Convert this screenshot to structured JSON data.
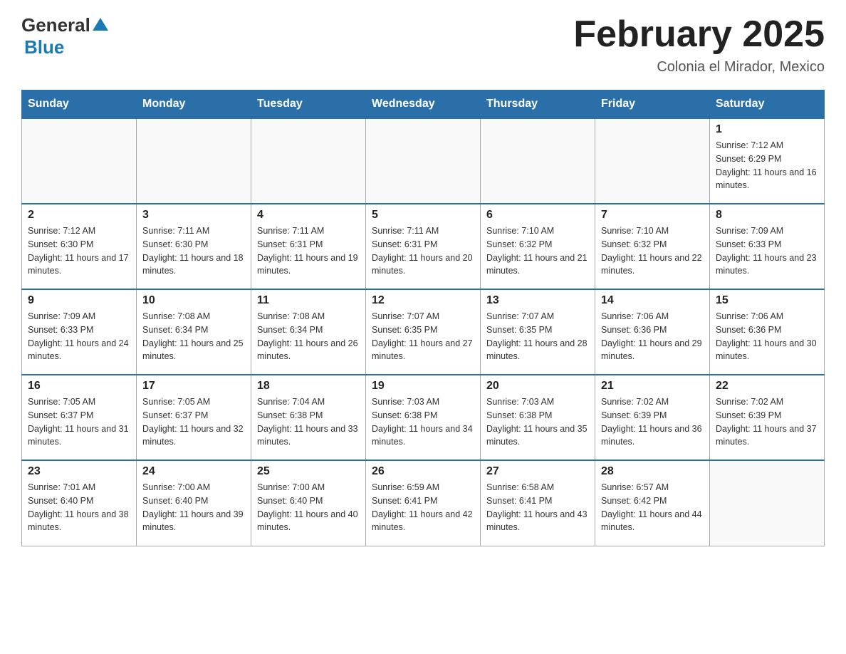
{
  "header": {
    "logo_general": "General",
    "logo_blue": "Blue",
    "month_title": "February 2025",
    "location": "Colonia el Mirador, Mexico"
  },
  "days_of_week": [
    "Sunday",
    "Monday",
    "Tuesday",
    "Wednesday",
    "Thursday",
    "Friday",
    "Saturday"
  ],
  "weeks": [
    [
      {
        "day": "",
        "info": ""
      },
      {
        "day": "",
        "info": ""
      },
      {
        "day": "",
        "info": ""
      },
      {
        "day": "",
        "info": ""
      },
      {
        "day": "",
        "info": ""
      },
      {
        "day": "",
        "info": ""
      },
      {
        "day": "1",
        "info": "Sunrise: 7:12 AM\nSunset: 6:29 PM\nDaylight: 11 hours and 16 minutes."
      }
    ],
    [
      {
        "day": "2",
        "info": "Sunrise: 7:12 AM\nSunset: 6:30 PM\nDaylight: 11 hours and 17 minutes."
      },
      {
        "day": "3",
        "info": "Sunrise: 7:11 AM\nSunset: 6:30 PM\nDaylight: 11 hours and 18 minutes."
      },
      {
        "day": "4",
        "info": "Sunrise: 7:11 AM\nSunset: 6:31 PM\nDaylight: 11 hours and 19 minutes."
      },
      {
        "day": "5",
        "info": "Sunrise: 7:11 AM\nSunset: 6:31 PM\nDaylight: 11 hours and 20 minutes."
      },
      {
        "day": "6",
        "info": "Sunrise: 7:10 AM\nSunset: 6:32 PM\nDaylight: 11 hours and 21 minutes."
      },
      {
        "day": "7",
        "info": "Sunrise: 7:10 AM\nSunset: 6:32 PM\nDaylight: 11 hours and 22 minutes."
      },
      {
        "day": "8",
        "info": "Sunrise: 7:09 AM\nSunset: 6:33 PM\nDaylight: 11 hours and 23 minutes."
      }
    ],
    [
      {
        "day": "9",
        "info": "Sunrise: 7:09 AM\nSunset: 6:33 PM\nDaylight: 11 hours and 24 minutes."
      },
      {
        "day": "10",
        "info": "Sunrise: 7:08 AM\nSunset: 6:34 PM\nDaylight: 11 hours and 25 minutes."
      },
      {
        "day": "11",
        "info": "Sunrise: 7:08 AM\nSunset: 6:34 PM\nDaylight: 11 hours and 26 minutes."
      },
      {
        "day": "12",
        "info": "Sunrise: 7:07 AM\nSunset: 6:35 PM\nDaylight: 11 hours and 27 minutes."
      },
      {
        "day": "13",
        "info": "Sunrise: 7:07 AM\nSunset: 6:35 PM\nDaylight: 11 hours and 28 minutes."
      },
      {
        "day": "14",
        "info": "Sunrise: 7:06 AM\nSunset: 6:36 PM\nDaylight: 11 hours and 29 minutes."
      },
      {
        "day": "15",
        "info": "Sunrise: 7:06 AM\nSunset: 6:36 PM\nDaylight: 11 hours and 30 minutes."
      }
    ],
    [
      {
        "day": "16",
        "info": "Sunrise: 7:05 AM\nSunset: 6:37 PM\nDaylight: 11 hours and 31 minutes."
      },
      {
        "day": "17",
        "info": "Sunrise: 7:05 AM\nSunset: 6:37 PM\nDaylight: 11 hours and 32 minutes."
      },
      {
        "day": "18",
        "info": "Sunrise: 7:04 AM\nSunset: 6:38 PM\nDaylight: 11 hours and 33 minutes."
      },
      {
        "day": "19",
        "info": "Sunrise: 7:03 AM\nSunset: 6:38 PM\nDaylight: 11 hours and 34 minutes."
      },
      {
        "day": "20",
        "info": "Sunrise: 7:03 AM\nSunset: 6:38 PM\nDaylight: 11 hours and 35 minutes."
      },
      {
        "day": "21",
        "info": "Sunrise: 7:02 AM\nSunset: 6:39 PM\nDaylight: 11 hours and 36 minutes."
      },
      {
        "day": "22",
        "info": "Sunrise: 7:02 AM\nSunset: 6:39 PM\nDaylight: 11 hours and 37 minutes."
      }
    ],
    [
      {
        "day": "23",
        "info": "Sunrise: 7:01 AM\nSunset: 6:40 PM\nDaylight: 11 hours and 38 minutes."
      },
      {
        "day": "24",
        "info": "Sunrise: 7:00 AM\nSunset: 6:40 PM\nDaylight: 11 hours and 39 minutes."
      },
      {
        "day": "25",
        "info": "Sunrise: 7:00 AM\nSunset: 6:40 PM\nDaylight: 11 hours and 40 minutes."
      },
      {
        "day": "26",
        "info": "Sunrise: 6:59 AM\nSunset: 6:41 PM\nDaylight: 11 hours and 42 minutes."
      },
      {
        "day": "27",
        "info": "Sunrise: 6:58 AM\nSunset: 6:41 PM\nDaylight: 11 hours and 43 minutes."
      },
      {
        "day": "28",
        "info": "Sunrise: 6:57 AM\nSunset: 6:42 PM\nDaylight: 11 hours and 44 minutes."
      },
      {
        "day": "",
        "info": ""
      }
    ]
  ]
}
